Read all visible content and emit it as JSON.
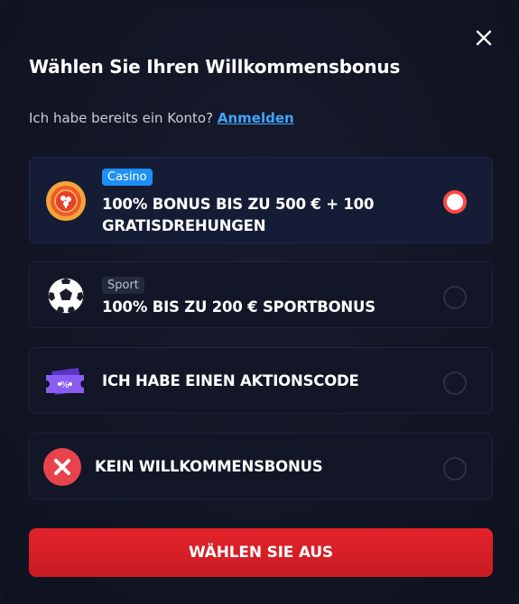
{
  "modal": {
    "title": "Wählen Sie Ihren Willkommensbonus",
    "account_prompt": "Ich habe bereits ein Konto?",
    "login_link": "Anmelden",
    "close_icon": "close-icon"
  },
  "options": [
    {
      "tag": "Casino",
      "label_line1": "100% BONUS BIS ZU 500 € + 100",
      "label_line2": "GRATISDREHUNGEN",
      "icon": "casino-chip-icon",
      "selected": true
    },
    {
      "tag": "Sport",
      "label": "100% BIS ZU 200 € SPORTBONUS",
      "icon": "soccer-ball-icon",
      "selected": false
    },
    {
      "label": "ICH HABE EINEN AKTIONSCODE",
      "icon": "promo-ticket-icon",
      "selected": false
    },
    {
      "label": "KEIN WILLKOMMENSBONUS",
      "icon": "no-bonus-x-icon",
      "selected": false
    }
  ],
  "submit_label": "WÄHLEN SIE AUS",
  "colors": {
    "background": "#111421",
    "accent_blue": "#3ea6ff",
    "casino_tag": "#1e8ff5",
    "submit_red": "#d91f26",
    "radio_selected": "#ff4a47"
  }
}
